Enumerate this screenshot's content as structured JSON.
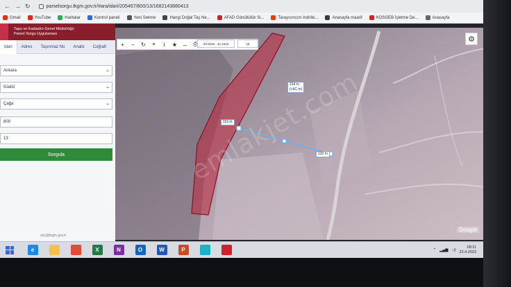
{
  "browser": {
    "url": "parselsorgu.tkgm.gov.tr/#ara/idari/205467/800/13/1682143880413",
    "bookmarks": [
      {
        "label": "Gmail",
        "color": "#d93025"
      },
      {
        "label": "YouTube",
        "color": "#e62117"
      },
      {
        "label": "Haritalar",
        "color": "#34a853"
      },
      {
        "label": "Kontrol paneli",
        "color": "#2c6bd8"
      },
      {
        "label": "Yeni Sekme",
        "color": "#555555"
      },
      {
        "label": "Hangi Doğal Taş Ne...",
        "color": "#444444"
      },
      {
        "label": "AFAD Gönüllülük Si...",
        "color": "#c62828"
      },
      {
        "label": "Tarayıcınızın indirile...",
        "color": "#d84315"
      },
      {
        "label": "Anasayfa maarif",
        "color": "#3b3b3b"
      },
      {
        "label": "KOSGEB İşletme De...",
        "color": "#c62828"
      },
      {
        "label": "Anasayfa",
        "color": "#666666"
      }
    ]
  },
  "app": {
    "header_line1": "Tapu ve Kadastro Genel Müdürlüğü",
    "header_line2": "Parsel Sorgu Uygulaması"
  },
  "panel": {
    "tabs": [
      {
        "label": "İdari",
        "active": true
      },
      {
        "label": "Adres",
        "active": false
      },
      {
        "label": "Taşınmaz No",
        "active": false
      },
      {
        "label": "Analiz",
        "active": false
      },
      {
        "label": "Coğrafi",
        "active": false
      }
    ],
    "province": "Ankara",
    "district": "Güdül",
    "neighborhood": "Çağa",
    "block": "800",
    "parcel": "13",
    "query_button": "Sorgula",
    "contact": "cbs@tkgm.gov.tr"
  },
  "map": {
    "coordinate": "40.5026 : 32.1633",
    "zoom": "16",
    "label_area": "214 m\n(+6C m)",
    "label_parcel": "115.m",
    "label_distance": "122 m",
    "attribution": "Google",
    "watermark": "emlakjet.com",
    "accent": "#c0263e"
  },
  "taskbar": {
    "apps": [
      {
        "name": "internet-explorer",
        "letter": "e",
        "color": "#1e88e5"
      },
      {
        "name": "file-explorer",
        "letter": "",
        "color": "#f2c14e"
      },
      {
        "name": "chrome",
        "letter": "",
        "color": "#e04b3a"
      },
      {
        "name": "excel",
        "letter": "X",
        "color": "#1f7a45"
      },
      {
        "name": "onenote",
        "letter": "N",
        "color": "#7b2f9e"
      },
      {
        "name": "outlook",
        "letter": "O",
        "color": "#1565c0"
      },
      {
        "name": "word",
        "letter": "W",
        "color": "#2456b3"
      },
      {
        "name": "powerpoint",
        "letter": "P",
        "color": "#d24726"
      },
      {
        "name": "edge",
        "letter": "",
        "color": "#1db0c9"
      },
      {
        "name": "opera",
        "letter": "",
        "color": "#d12030"
      }
    ],
    "time": "09:11",
    "date": "22.4.2023"
  }
}
